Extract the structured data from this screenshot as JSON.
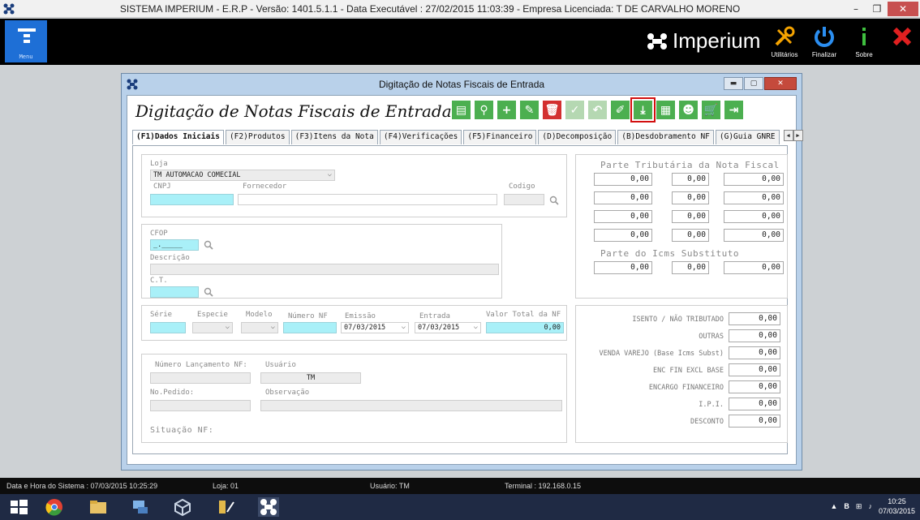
{
  "os_window": {
    "title": "SISTEMA IMPERIUM - E.R.P - Versão: 1401.5.1.1 - Data Executável : 27/02/2015 11:03:39 - Empresa Licenciada: T DE CARVALHO MORENO",
    "minimize": "–",
    "restore": "❐",
    "close": "✕"
  },
  "topbar": {
    "menu_label": "Menu",
    "brand": "Imperium",
    "actions": [
      {
        "label": "Utilitários",
        "icon": "tools-icon"
      },
      {
        "label": "Finalizar",
        "icon": "power-icon"
      },
      {
        "label": "Sobre",
        "icon": "info-icon"
      },
      {
        "label": "",
        "icon": "close-icon"
      }
    ]
  },
  "window": {
    "title": "Digitação de Notas Fiscais de Entrada",
    "form_title": "Digitação de Notas Fiscais de Entrada",
    "toolbar": [
      {
        "name": "document-icon",
        "glyph": "▤"
      },
      {
        "name": "search-icon",
        "glyph": "⚲"
      },
      {
        "name": "add-icon",
        "glyph": "+"
      },
      {
        "name": "edit-icon",
        "glyph": "✎"
      },
      {
        "name": "delete-icon",
        "glyph": "🗑"
      },
      {
        "name": "confirm-icon",
        "glyph": "✓"
      },
      {
        "name": "undo-icon",
        "glyph": "↶"
      },
      {
        "name": "clear-icon",
        "glyph": "✐"
      },
      {
        "name": "import-icon",
        "glyph": "⤓"
      },
      {
        "name": "factory-icon",
        "glyph": "▦"
      },
      {
        "name": "user-icon",
        "glyph": "☻"
      },
      {
        "name": "cart-icon",
        "glyph": "🛒"
      },
      {
        "name": "exit-icon",
        "glyph": "⇥"
      }
    ],
    "tabs": [
      "(F1)Dados Iniciais",
      "(F2)Produtos",
      "(F3)Itens da Nota",
      "(F4)Verificações",
      "(F5)Financeiro",
      "(D)Decomposição",
      "(B)Desdobramento NF",
      "(G)Guia GNRE"
    ]
  },
  "form": {
    "loja_label": "Loja",
    "loja_value": "TM AUTOMACAO COMECIAL",
    "cnpj_label": "CNPJ",
    "fornecedor_label": "Fornecedor",
    "codigo_label": "Codigo",
    "cfop_label": "CFOP",
    "cfop_value": "_._____",
    "descricao_label": "Descrição",
    "ct_label": "C.T.",
    "serie_label": "Série",
    "especie_label": "Especie",
    "modelo_label": "Modelo",
    "numero_nf_label": "Número NF",
    "emissao_label": "Emissão",
    "emissao_value": "07/03/2015",
    "entrada_label": "Entrada",
    "entrada_value": "07/03/2015",
    "valor_total_label": "Valor Total da NF",
    "valor_total_value": "0,00",
    "numero_lancamento_label": "Número Lançamento NF:",
    "usuario_label": "Usuário",
    "usuario_value": "TM",
    "no_pedido_label": "No.Pedido:",
    "observacao_label": "Observação",
    "situacao_label": "Situação NF:"
  },
  "tributaria": {
    "title": "Parte Tributária da Nota Fiscal",
    "rows": [
      [
        "0,00",
        "0,00",
        "0,00"
      ],
      [
        "0,00",
        "0,00",
        "0,00"
      ],
      [
        "0,00",
        "0,00",
        "0,00"
      ],
      [
        "0,00",
        "0,00",
        "0,00"
      ]
    ],
    "icms_title": "Parte do Icms Substituto",
    "icms_row": [
      "0,00",
      "0,00",
      "0,00"
    ]
  },
  "totais": [
    {
      "label": "ISENTO / NÃO TRIBUTADO",
      "value": "0,00"
    },
    {
      "label": "OUTRAS",
      "value": "0,00"
    },
    {
      "label": "VENDA VAREJO (Base Icms Subst)",
      "value": "0,00"
    },
    {
      "label": "ENC FIN EXCL BASE",
      "value": "0,00"
    },
    {
      "label": "ENCARGO FINANCEIRO",
      "value": "0,00"
    },
    {
      "label": "I.P.I.",
      "value": "0,00"
    },
    {
      "label": "DESCONTO",
      "value": "0,00"
    }
  ],
  "statusbar": {
    "datetime": "Data e Hora do Sistema : 07/03/2015 10:25:29",
    "loja": "Loja: 01",
    "usuario": "Usuário: TM",
    "terminal": "Terminal : 192.168.0.15"
  },
  "taskbar": {
    "time": "10:25",
    "date": "07/03/2015",
    "lang": "B"
  }
}
